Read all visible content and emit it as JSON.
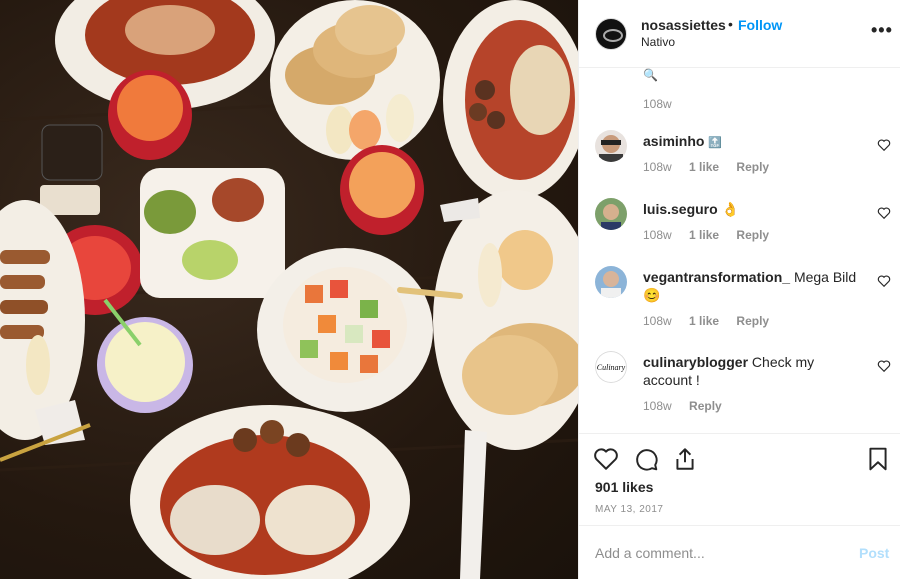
{
  "post": {
    "username": "nosassiettes",
    "separator": "•",
    "follow_label": "Follow",
    "location": "Nativo",
    "more_label": "•••",
    "photo_alt": "photo"
  },
  "comments_section": {
    "first_emoji": "🔍",
    "first_time": "108w",
    "items": [
      {
        "username": "asiminho",
        "text": "🔝",
        "time": "108w",
        "likes": "1 like",
        "reply": "Reply"
      },
      {
        "username": "luis.seguro",
        "text": "👌",
        "time": "108w",
        "likes": "1 like",
        "reply": "Reply"
      },
      {
        "username": "vegantransformation_",
        "text": "Mega Bild 😊",
        "time": "108w",
        "likes": "1 like",
        "reply": "Reply"
      },
      {
        "username": "culinaryblogger",
        "text": "Check my account !",
        "time": "108w",
        "likes": "",
        "reply": "Reply"
      }
    ]
  },
  "actions": {
    "like_icon": "heart-icon",
    "comment_icon": "comment-icon",
    "share_icon": "share-icon",
    "save_icon": "bookmark-icon",
    "likes_count": "901 likes",
    "date": "MAY 13, 2017"
  },
  "add_comment": {
    "placeholder": "Add a comment...",
    "post_label": "Post"
  },
  "colors": {
    "follow": "#0095f6",
    "post_disabled": "#b2dffc",
    "meta": "#8e8e8e",
    "text": "#262626",
    "border": "#efefef"
  }
}
